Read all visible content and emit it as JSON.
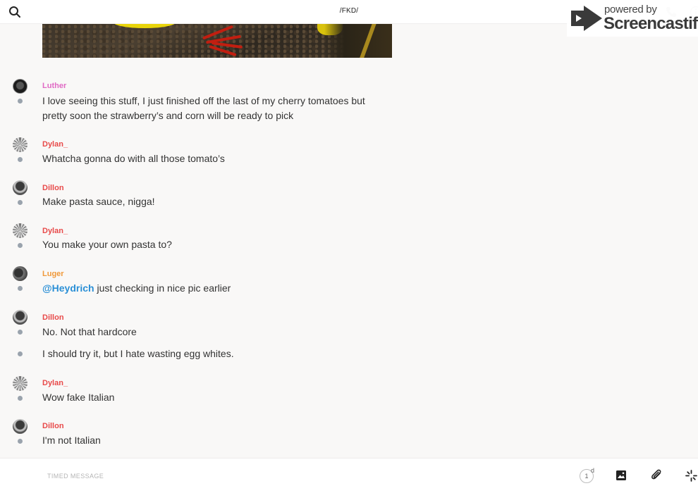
{
  "header": {
    "title": "/FKD/",
    "search_icon": "search-icon",
    "phone_icon": "phone-icon",
    "info_icon": "info-icon"
  },
  "watermark": {
    "line1": "powered by",
    "line2": "Screencastify"
  },
  "messages": [
    {
      "user": "Luther",
      "color": "#e06ac4",
      "text_lines": [
        "I love seeing this stuff, I just finished off the last of my cherry tomatoes but",
        "pretty soon the strawberry’s and corn will be ready to pick"
      ]
    },
    {
      "user": "Dylan_",
      "color": "#e84a4a",
      "text": "Whatcha gonna do with all those tomato’s"
    },
    {
      "user": "Dillon",
      "color": "#e84a4a",
      "text": "Make pasta sauce, nigga!"
    },
    {
      "user": "Dylan_",
      "color": "#e84a4a",
      "text": "You make your own pasta to?"
    },
    {
      "user": "Luger",
      "color": "#f0993a",
      "mention": "@Heydrich",
      "text": " just checking in nice pic earlier"
    },
    {
      "user": "Dillon",
      "color": "#e84a4a",
      "text": "No. Not that hardcore",
      "followup": "I should try it, but I hate wasting egg whites."
    },
    {
      "user": "Dylan_",
      "color": "#e84a4a",
      "text": "Wow fake Italian"
    },
    {
      "user": "Dillon",
      "color": "#e84a4a",
      "text": "I'm not Italian"
    }
  ],
  "composer": {
    "placeholder": "TIMED MESSAGE",
    "timer_value": "1",
    "timer_unit": "d",
    "image_icon": "image-icon",
    "attach_icon": "paperclip-icon",
    "spark_icon": "sparkle-icon"
  }
}
